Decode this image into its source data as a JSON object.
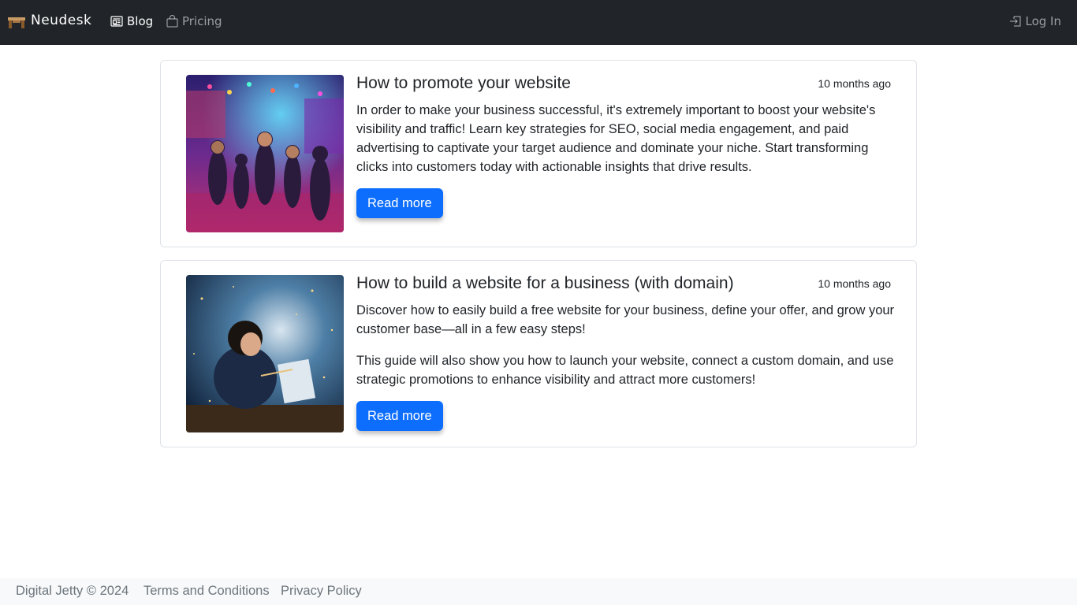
{
  "navbar": {
    "brand": "Neudesk",
    "brand_icon": "desk-icon",
    "links": [
      {
        "label": "Blog",
        "icon": "newspaper-icon",
        "active": true
      },
      {
        "label": "Pricing",
        "icon": "bag-icon",
        "active": false
      }
    ],
    "login": {
      "label": "Log In",
      "icon": "login-icon"
    }
  },
  "posts": [
    {
      "title": "How to promote your website",
      "time": "10 months ago",
      "paragraphs": [
        "In order to make your business successful, it's extremely important to boost your website's visibility and traffic! Learn key strategies for SEO, social media engagement, and paid advertising to captivate your target audience and dominate your niche. Start transforming clicks into customers today with actionable insights that drive results."
      ],
      "button": "Read more"
    },
    {
      "title": "How to build a website for a business (with domain)",
      "time": "10 months ago",
      "paragraphs": [
        "Discover how to easily build a free website for your business, define your offer, and grow your customer base—all in a few easy steps!",
        "This guide will also show you how to launch your website, connect a custom domain, and use strategic promotions to enhance visibility and attract more customers!"
      ],
      "button": "Read more"
    }
  ],
  "footer": {
    "copyright": "Digital Jetty © 2024",
    "terms": "Terms and Conditions",
    "privacy": "Privacy Policy"
  },
  "colors": {
    "navbar_bg": "#212529",
    "primary": "#0d6efd",
    "footer_bg": "#f8f9fa",
    "muted": "#6c757d"
  }
}
